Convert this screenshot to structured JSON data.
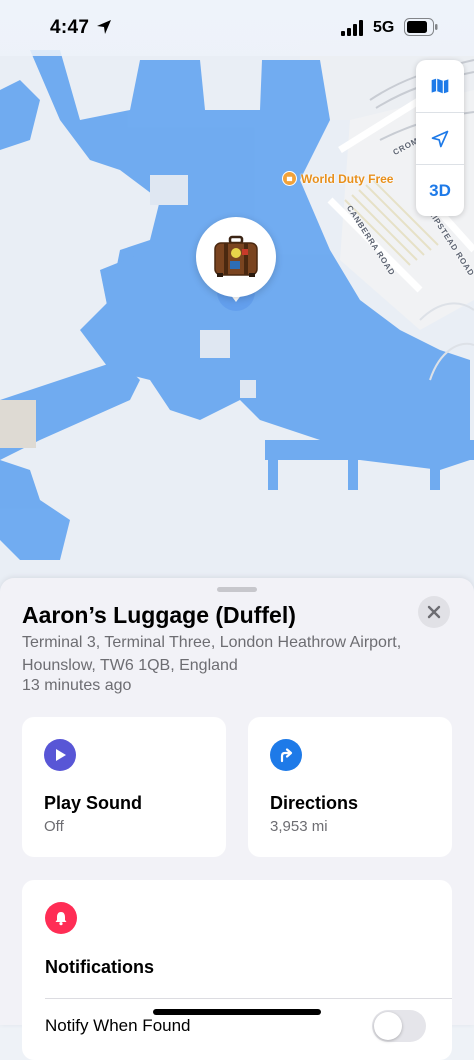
{
  "status_bar": {
    "time": "4:47",
    "network": "5G"
  },
  "map": {
    "poi": "World Duty Free",
    "roads": [
      "CROM",
      "CANBERRA ROAD",
      "CHIPSTEAD ROAD"
    ],
    "controls": {
      "map_mode_icon": "map-icon",
      "tracking_icon": "location-arrow-icon",
      "three_d_label": "3D"
    },
    "pin_icon": "luggage-icon"
  },
  "item": {
    "name": "Aaron’s Luggage (Duffel)",
    "address": "Terminal 3, Terminal Three, London Heathrow Airport, Hounslow, TW6 1QB, England",
    "last_seen": "13 minutes ago"
  },
  "actions": {
    "play_sound": {
      "label": "Play Sound",
      "sub": "Off",
      "icon": "play-icon",
      "color": "#5856d6"
    },
    "directions": {
      "label": "Directions",
      "sub": "3,953 mi",
      "icon": "turn-right-arrow-icon",
      "color": "#1e7ae8"
    }
  },
  "notifications": {
    "label": "Notifications",
    "icon": "bell-icon",
    "color": "#ff2d55",
    "notify_when_found": {
      "label": "Notify When Found",
      "enabled": false
    }
  },
  "colors": {
    "terminal_fill": "#6aa8f0",
    "map_background": "#e9eef5",
    "accent": "#1e7ae8"
  }
}
